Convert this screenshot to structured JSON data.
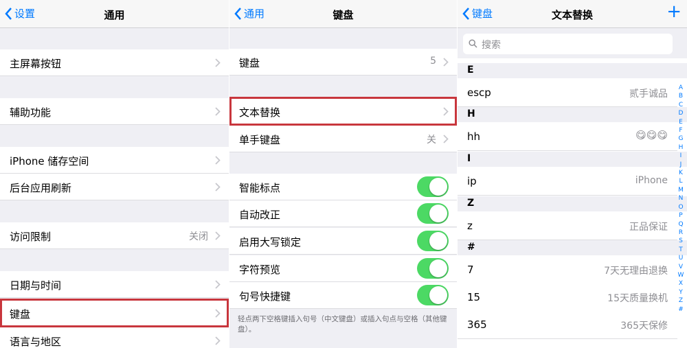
{
  "panel1": {
    "back": "设置",
    "title": "通用",
    "rows": [
      "主屏幕按钮",
      "辅助功能",
      "iPhone 储存空间",
      "后台应用刷新",
      "访问限制",
      "日期与时间",
      "键盘",
      "语言与地区"
    ],
    "restrictions_value": "关闭"
  },
  "panel2": {
    "back": "通用",
    "title": "键盘",
    "rows": [
      "键盘",
      "文本替换",
      "单手键盘",
      "智能标点",
      "自动改正",
      "启用大写锁定",
      "字符预览",
      "句号快捷键"
    ],
    "keyboards_count": "5",
    "one_hand_value": "关",
    "footnote": "轻点两下空格键插入句号（中文键盘）或插入句点与空格（其他键盘）。"
  },
  "panel3": {
    "back": "键盘",
    "title": "文本替换",
    "add": "+",
    "search_placeholder": "搜索",
    "sections": [
      "E",
      "H",
      "I",
      "Z",
      "#"
    ],
    "shortcuts": [
      "escp",
      "hh",
      "ip",
      "z",
      "7",
      "15",
      "365"
    ],
    "phrases": [
      "贰手诚品",
      "😋😋😋",
      "iPhone",
      "正品保证",
      "7天无理由退换",
      "15天质量换机",
      "365天保修"
    ],
    "index": [
      "A",
      "B",
      "C",
      "D",
      "E",
      "F",
      "G",
      "H",
      "I",
      "J",
      "K",
      "L",
      "M",
      "N",
      "O",
      "P",
      "Q",
      "R",
      "S",
      "T",
      "U",
      "V",
      "W",
      "X",
      "Y",
      "Z",
      "#"
    ]
  },
  "colors": {
    "accent": "#007aff",
    "switch_on": "#4cd964",
    "highlight": "#c8363d",
    "group_bg": "#efeff4"
  }
}
